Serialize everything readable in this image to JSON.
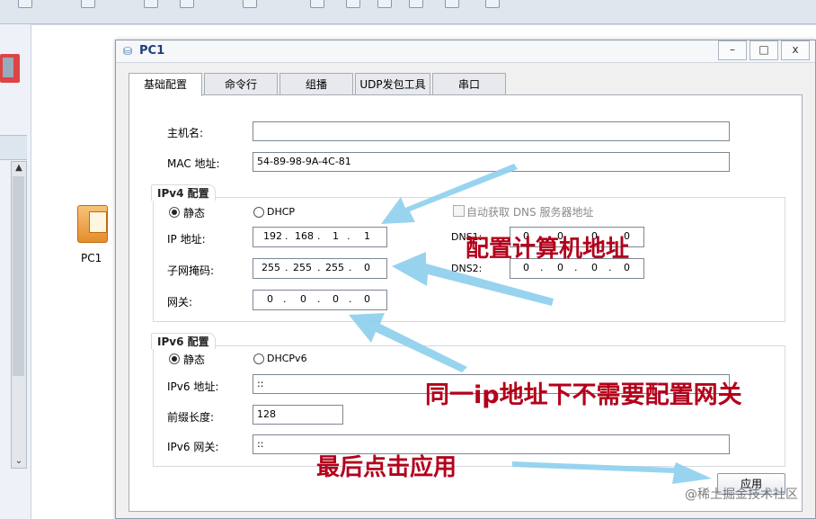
{
  "window": {
    "title": "PC1",
    "min": "–",
    "max": "□",
    "close": "x"
  },
  "device": {
    "label": "PC1"
  },
  "left_scroll": {
    "up": "▲",
    "down": "⌄"
  },
  "tabs": [
    {
      "label": "基础配置",
      "active": true
    },
    {
      "label": "命令行",
      "active": false
    },
    {
      "label": "组播",
      "active": false
    },
    {
      "label": "UDP发包工具",
      "active": false
    },
    {
      "label": "串口",
      "active": false
    }
  ],
  "basic": {
    "hostname_label": "主机名:",
    "hostname_value": "",
    "mac_label": "MAC 地址:",
    "mac_value": "54-89-98-9A-4C-81"
  },
  "ipv4": {
    "title": "IPv4 配置",
    "static_label": "静态",
    "dhcp_label": "DHCP",
    "ip_label": "IP 地址:",
    "ip": [
      "192",
      "168",
      "1",
      "1"
    ],
    "mask_label": "子网掩码:",
    "mask": [
      "255",
      "255",
      "255",
      "0"
    ],
    "gateway_label": "网关:",
    "gateway": [
      "0",
      "0",
      "0",
      "0"
    ],
    "auto_dns_label": "自动获取 DNS 服务器地址",
    "dns1_label": "DNS1:",
    "dns1": [
      "0",
      "0",
      "0",
      "0"
    ],
    "dns2_label": "DNS2:",
    "dns2": [
      "0",
      "0",
      "0",
      "0"
    ]
  },
  "ipv6": {
    "title": "IPv6 配置",
    "static_label": "静态",
    "dhcp_label": "DHCPv6",
    "ip_label": "IPv6 地址:",
    "ip_value": "::",
    "prefix_label": "前缀长度:",
    "prefix_value": "128",
    "gateway_label": "IPv6 网关:",
    "gateway_value": "::"
  },
  "apply_label": "应用",
  "annotations": {
    "a1": "配置计算机地址",
    "a2": "同一ip地址下不需要配置网关",
    "a3": "最后点击应用"
  },
  "watermark": "@稀土掘金技术社区",
  "colors": {
    "annotation": "#b3001b",
    "arrow": "#8fd0ee"
  }
}
